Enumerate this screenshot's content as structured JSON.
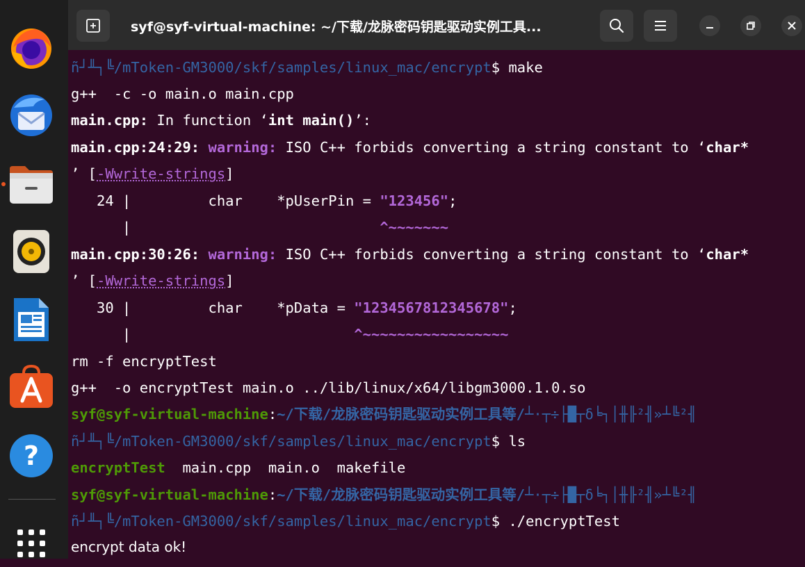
{
  "window": {
    "title": "syf@syf-virtual-machine: ~/下载/龙脉密码钥匙驱动实例工具..."
  },
  "dock": {
    "items": [
      {
        "name": "firefox",
        "icon": "firefox-icon"
      },
      {
        "name": "thunderbird",
        "icon": "thunderbird-icon"
      },
      {
        "name": "files",
        "icon": "files-icon"
      },
      {
        "name": "rhythmbox",
        "icon": "rhythmbox-icon"
      },
      {
        "name": "libreoffice-writer",
        "icon": "writer-icon"
      },
      {
        "name": "software",
        "icon": "software-center-icon"
      },
      {
        "name": "help",
        "icon": "help-icon"
      },
      {
        "name": "show-apps",
        "icon": "app-grid-icon"
      }
    ],
    "help_glyph": "?",
    "accent": "#e95420"
  },
  "terminal": {
    "garbled_prefix": "ñ┘╨┐╚",
    "path_encrypt": "/mToken-GM3000/skf/samples/linux_mac/encrypt",
    "prompt_user": "syf@syf-virtual-machine",
    "prompt_colon": ":",
    "prompt_path_cn": "~/下载/龙脉密码钥匙驱动实例工具等/",
    "prompt_garble_tail": "┴·┬÷├█┬δ╘┐│╫╟²╢»┴╚²╢",
    "dollar": "$ ",
    "lines": {
      "l1_cmd": "make",
      "l2": "g++  -c -o main.o main.cpp",
      "l3_file": "main.cpp:",
      "l3_text": " In function ‘",
      "l3_func": "int main()",
      "l3_end": "’:",
      "l4_loc": "main.cpp:24:29:",
      "l4_warn": "warning:",
      "l4_text": " ISO C++ forbids converting a string constant to ‘",
      "l4_char": "char*",
      "l5_open": "’ [",
      "l5_flag": "-Wwrite-strings",
      "l5_close": "]",
      "l6_a": "   24 |         char    *pUserPin = ",
      "l6_str": "\"123456\"",
      "l6_b": ";",
      "l7_a": "      |                             ",
      "l7_caret": "^~~~~~~~",
      "l8_loc": "main.cpp:30:26:",
      "l8_warn": "warning:",
      "l8_text": " ISO C++ forbids converting a string constant to ‘",
      "l8_char": "char*",
      "l9_open": "’ [",
      "l9_flag": "-Wwrite-strings",
      "l9_close": "]",
      "l10_a": "   30 |         char    *pData = ",
      "l10_str": "\"1234567812345678\"",
      "l10_b": ";",
      "l11_a": "      |                          ",
      "l11_caret": "^~~~~~~~~~~~~~~~~~",
      "l12": "rm -f encryptTest",
      "l13": "g++  -o encryptTest main.o ../lib/linux/x64/libgm3000.1.0.so",
      "l15_cmd": "ls",
      "l16_exec": "encryptTest",
      "l16_rest": "  main.cpp  main.o  makefile",
      "l18_cmd": "./encryptTest",
      "l19": "encrypt data ok!"
    }
  }
}
